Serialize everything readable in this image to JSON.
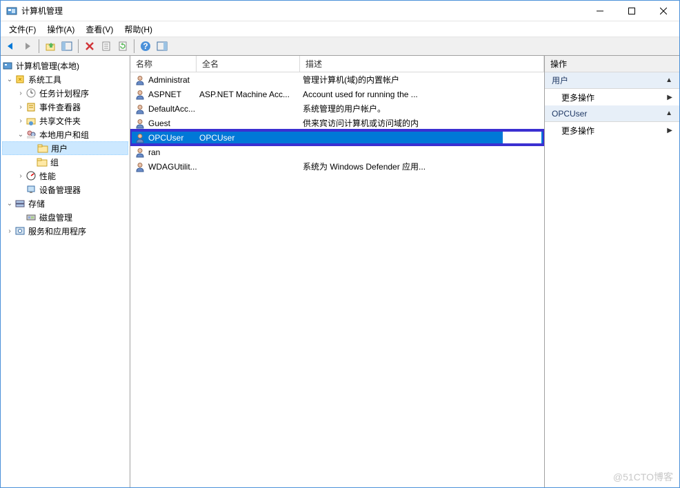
{
  "window": {
    "title": "计算机管理"
  },
  "menubar": {
    "file": "文件(F)",
    "action": "操作(A)",
    "view": "查看(V)",
    "help": "帮助(H)"
  },
  "tree": {
    "root": "计算机管理(本地)",
    "systools": "系统工具",
    "taskscheduler": "任务计划程序",
    "eventviewer": "事件查看器",
    "sharedfolders": "共享文件夹",
    "localusers": "本地用户和组",
    "users": "用户",
    "groups": "组",
    "performance": "性能",
    "devicemgr": "设备管理器",
    "storage": "存储",
    "diskmgmt": "磁盘管理",
    "services": "服务和应用程序"
  },
  "list": {
    "headers": {
      "name": "名称",
      "fullname": "全名",
      "description": "描述"
    },
    "rows": [
      {
        "name": "Administrat",
        "fullname": "",
        "description": "管理计算机(域)的内置帐户"
      },
      {
        "name": "ASPNET",
        "fullname": "ASP.NET Machine Acc...",
        "description": "Account used for running the ..."
      },
      {
        "name": "DefaultAcc...",
        "fullname": "",
        "description": "系统管理的用户帐户。"
      },
      {
        "name": "Guest",
        "fullname": "",
        "description": "供来宾访问计算机或访问域的内"
      },
      {
        "name": "OPCUser",
        "fullname": "OPCUser",
        "description": ""
      },
      {
        "name": "ran",
        "fullname": "",
        "description": ""
      },
      {
        "name": "WDAGUtilit...",
        "fullname": "",
        "description": "系统为 Windows Defender 应用..."
      }
    ],
    "selected_index": 4
  },
  "actions": {
    "header": "操作",
    "section1_title": "用户",
    "more_ops": "更多操作",
    "section2_title": "OPCUser"
  },
  "watermark": "@51CTO博客"
}
